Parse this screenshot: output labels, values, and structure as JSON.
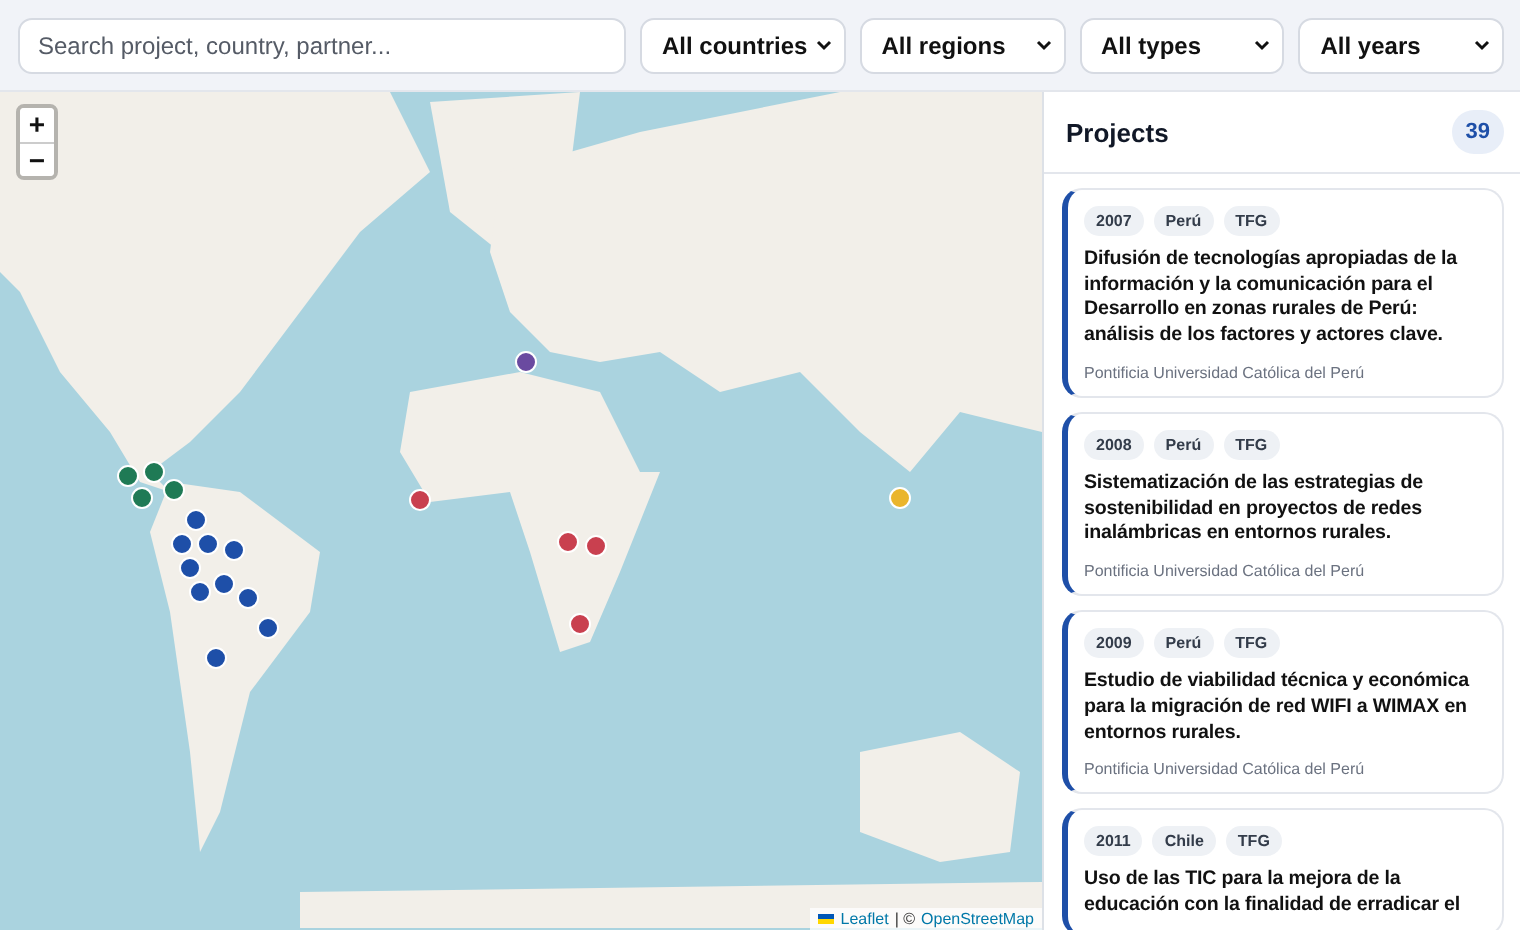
{
  "filters": {
    "search": {
      "placeholder": "Search project, country, partner..."
    },
    "selects": [
      {
        "value": "All countries"
      },
      {
        "value": "All regions"
      },
      {
        "value": "All types"
      },
      {
        "value": "All years"
      }
    ]
  },
  "map": {
    "zoom_in": "+",
    "zoom_out": "−",
    "markers": [
      {
        "color": "#1f7a55"
      },
      {
        "color": "#1f7a55"
      },
      {
        "color": "#1f7a55"
      },
      {
        "color": "#1f7a55"
      },
      {
        "color": "#1e4fa8"
      },
      {
        "color": "#1e4fa8"
      },
      {
        "color": "#1e4fa8"
      },
      {
        "color": "#1e4fa8"
      },
      {
        "color": "#1e4fa8"
      },
      {
        "color": "#1e4fa8"
      },
      {
        "color": "#1e4fa8"
      },
      {
        "color": "#1e4fa8"
      },
      {
        "color": "#1e4fa8"
      },
      {
        "color": "#1e4fa8"
      },
      {
        "color": "#6a4aa0"
      },
      {
        "color": "#c9404f"
      },
      {
        "color": "#c9404f"
      },
      {
        "color": "#c9404f"
      },
      {
        "color": "#c9404f"
      },
      {
        "color": "#eab52c"
      }
    ],
    "attribution": {
      "link": "Leaflet",
      "separator": "| ©",
      "source": "OpenStreetMap"
    }
  },
  "projects": {
    "title": "Projects",
    "count": "39",
    "items": [
      {
        "year": "2007",
        "country": "Perú",
        "type": "TFG",
        "title": "Difusión de tecnologías apropiadas de la información y la comunicación para el Desarrollo en zonas rurales de Perú: análisis de los factores y actores clave.",
        "partner": "Pontificia Universidad Católica del Perú"
      },
      {
        "year": "2008",
        "country": "Perú",
        "type": "TFG",
        "title": "Sistematización de las estrategias de sostenibilidad en proyectos de redes inalámbricas en entornos rurales.",
        "partner": "Pontificia Universidad Católica del Perú"
      },
      {
        "year": "2009",
        "country": "Perú",
        "type": "TFG",
        "title": "Estudio de viabilidad técnica y económica para la migración de red WIFI a WIMAX en entornos rurales.",
        "partner": "Pontificia Universidad Católica del Perú"
      },
      {
        "year": "2011",
        "country": "Chile",
        "type": "TFG",
        "title": "Uso de las TIC para la mejora de la educación con la finalidad de erradicar el"
      }
    ]
  }
}
